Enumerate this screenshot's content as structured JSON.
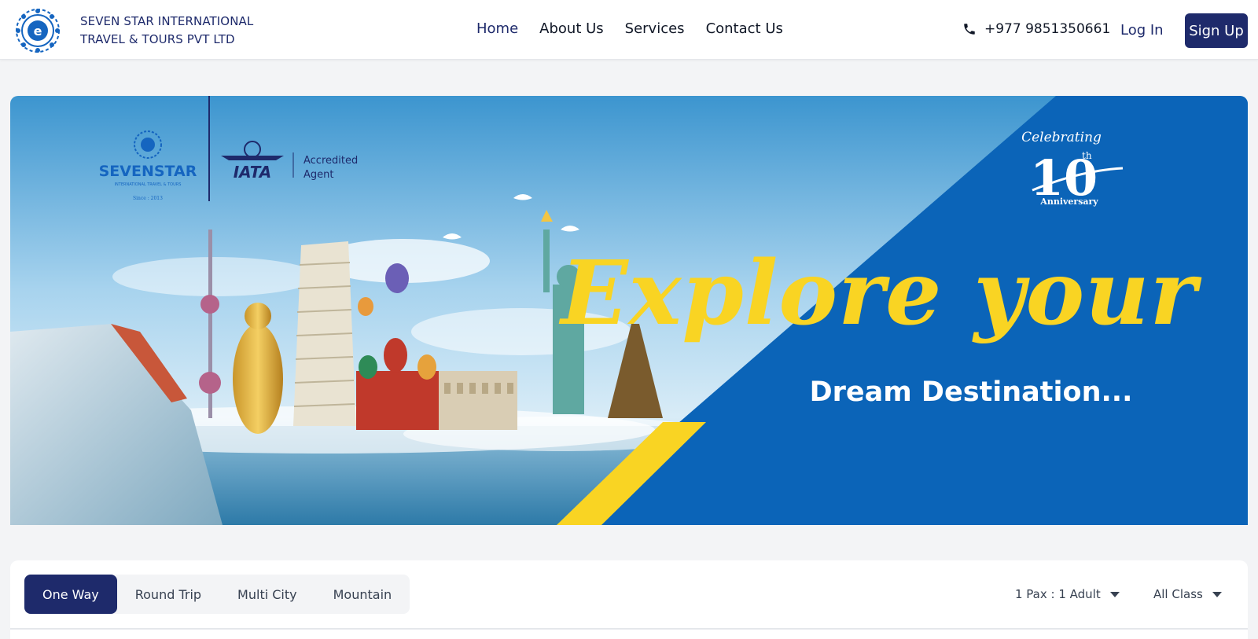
{
  "brand": {
    "line1": "SEVEN STAR INTERNATIONAL",
    "line2": "TRAVEL & TOURS PVT LTD"
  },
  "nav": {
    "items": [
      {
        "label": "Home",
        "active": true
      },
      {
        "label": "About Us",
        "active": false
      },
      {
        "label": "Services",
        "active": false
      },
      {
        "label": "Contact Us",
        "active": false
      }
    ]
  },
  "header": {
    "phone": "+977 9851350661",
    "login_label": "Log In",
    "signup_label": "Sign Up"
  },
  "hero": {
    "logo_name": "SEVENSTAR",
    "logo_sub": "INTERNATIONAL TRAVEL & TOURS",
    "logo_since": "Since : 2013",
    "iata": "IATA",
    "accredited_line1": "Accredited",
    "accredited_line2": "Agent",
    "celebrating": "Celebrating",
    "anniversary_number": "10",
    "anniversary_suffix": "th",
    "anniversary_label": "Anniversary",
    "headline": "Explore your",
    "subheadline": "Dream Destination..."
  },
  "search": {
    "tabs": [
      {
        "label": "One Way",
        "active": true
      },
      {
        "label": "Round Trip",
        "active": false
      },
      {
        "label": "Multi City",
        "active": false
      },
      {
        "label": "Mountain",
        "active": false
      }
    ],
    "passengers": "1 Pax : 1 Adult",
    "cabin_class": "All Class"
  },
  "colors": {
    "primary": "#1e2a6b",
    "hero_blue": "#0b64b8",
    "hero_yellow": "#f9d423"
  }
}
